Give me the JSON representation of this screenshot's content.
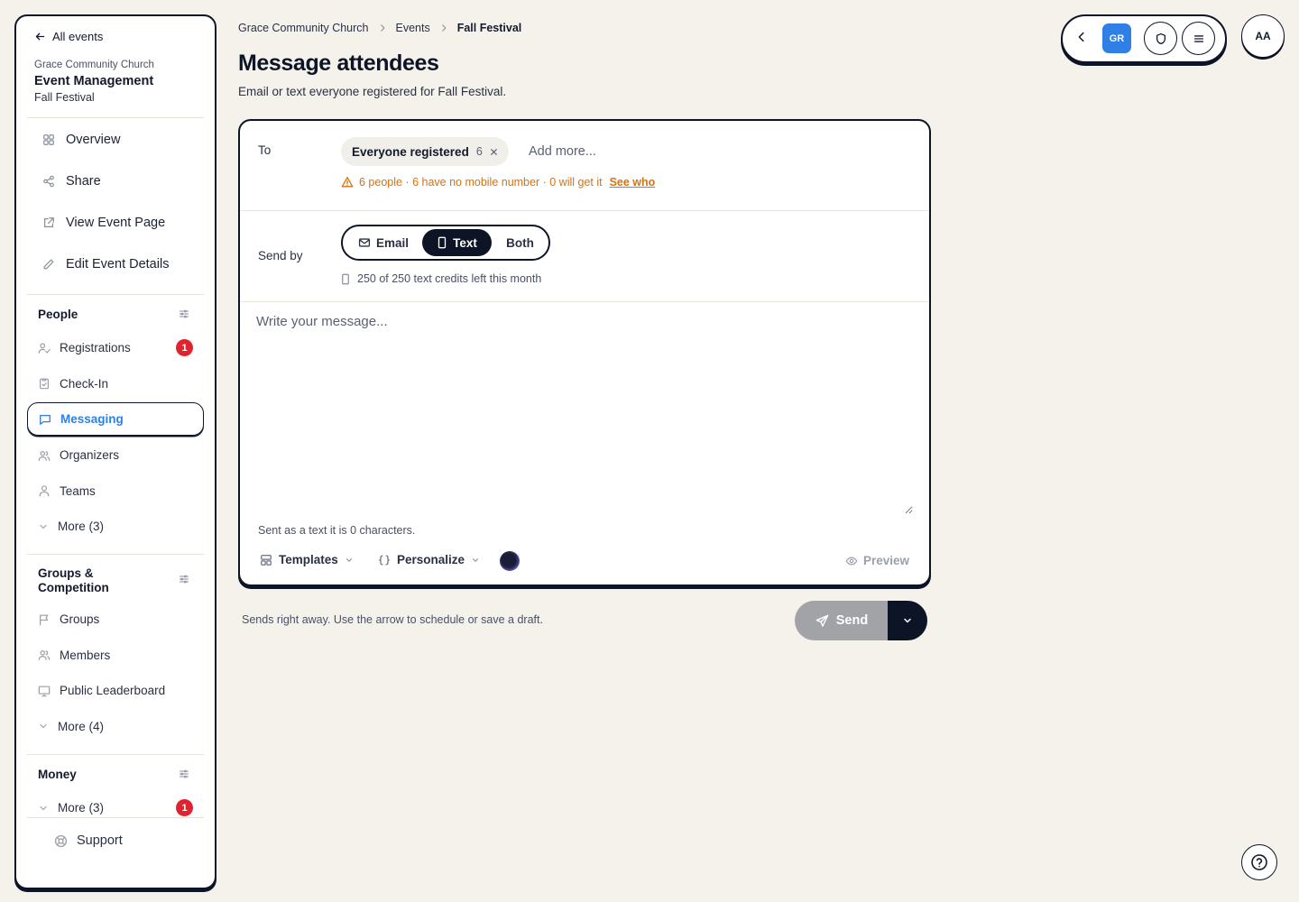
{
  "sidebar": {
    "back_label": "All events",
    "org_name": "Grace Community Church",
    "app_title": "Event Management",
    "event_name": "Fall Festival",
    "main_items": [
      {
        "label": "Overview",
        "icon": "grid-icon"
      },
      {
        "label": "Share",
        "icon": "share-icon"
      },
      {
        "label": "View Event Page",
        "icon": "external-link-icon"
      },
      {
        "label": "Edit Event Details",
        "icon": "pencil-icon"
      }
    ],
    "people": {
      "title": "People",
      "items": [
        {
          "label": "Registrations",
          "icon": "user-check-icon",
          "badge": "1"
        },
        {
          "label": "Check-In",
          "icon": "clipboard-check-icon"
        },
        {
          "label": "Messaging",
          "icon": "message-icon",
          "active": true
        },
        {
          "label": "Organizers",
          "icon": "users-icon"
        },
        {
          "label": "Teams",
          "icon": "team-icon"
        },
        {
          "label": "More (3)",
          "icon": "chevron-down-icon"
        }
      ]
    },
    "groups": {
      "title": "Groups & Competition",
      "items": [
        {
          "label": "Groups",
          "icon": "flag-icon"
        },
        {
          "label": "Members",
          "icon": "users-icon"
        },
        {
          "label": "Public Leaderboard",
          "icon": "monitor-icon"
        },
        {
          "label": "More (4)",
          "icon": "chevron-down-icon"
        }
      ]
    },
    "money": {
      "title": "Money",
      "items": [
        {
          "label": "More (3)",
          "icon": "chevron-down-icon",
          "badge": "1"
        }
      ]
    },
    "support_label": "Support"
  },
  "breadcrumb": [
    "Grace Community Church",
    "Events",
    "Fall Festival"
  ],
  "page": {
    "title": "Message attendees",
    "subtitle": "Email or text everyone registered for Fall Festival."
  },
  "topbar": {
    "workspace_initials": "GR",
    "avatar_initials": "AA"
  },
  "composer": {
    "to_label": "To",
    "recipient_chip": {
      "label": "Everyone registered",
      "count": "6"
    },
    "add_more_placeholder": "Add more...",
    "warning_text": "6 people · 6 have no mobile number · 0 will get it",
    "warning_link": "See who",
    "send_by_label": "Send by",
    "channels": [
      {
        "label": "Email",
        "icon": "mail-icon"
      },
      {
        "label": "Text",
        "icon": "phone-icon",
        "selected": true
      },
      {
        "label": "Both"
      }
    ],
    "credits_text": "250 of 250 text credits left this month",
    "message_placeholder": "Write your message...",
    "message_value": "",
    "char_count_text": "Sent as a text it is 0 characters.",
    "templates_label": "Templates",
    "personalize_label": "Personalize",
    "preview_label": "Preview"
  },
  "footer": {
    "note": "Sends right away. Use the arrow to schedule or save a draft.",
    "send_label": "Send"
  },
  "colors": {
    "accent": "#2f7fe6",
    "ink": "#0d1426",
    "warning": "#d77210",
    "badge": "#e0242f",
    "background": "#f5f2ec"
  }
}
